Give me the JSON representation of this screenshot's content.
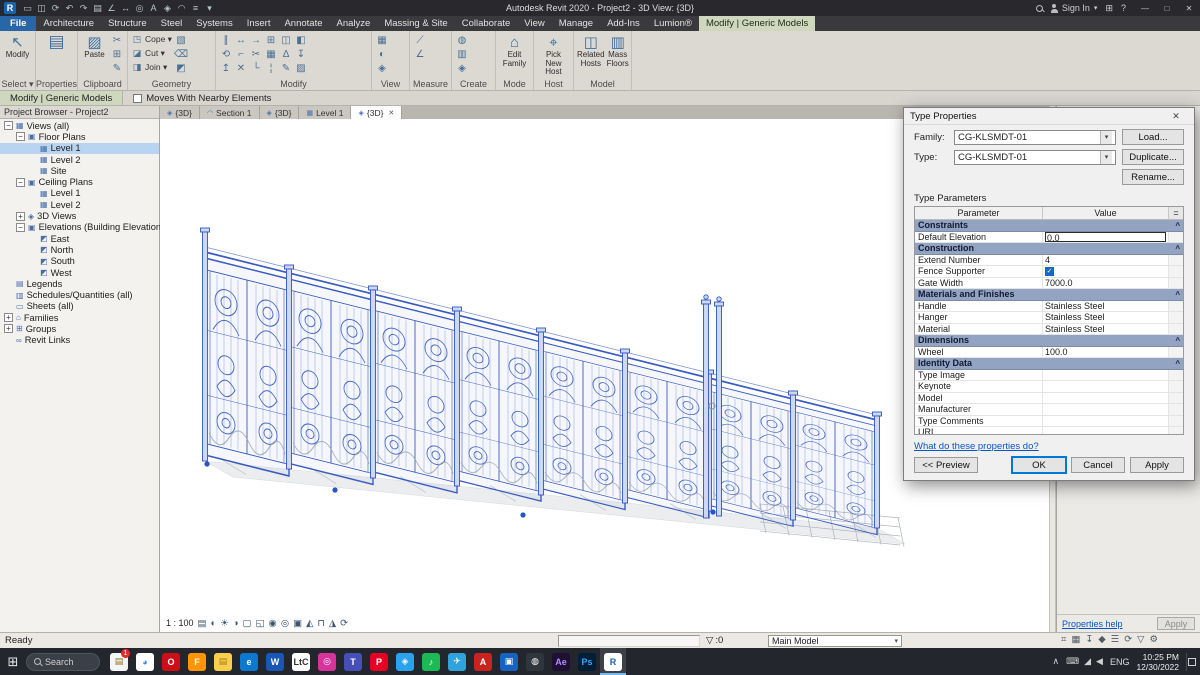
{
  "title_bar": {
    "app_icon_letter": "R",
    "quick_access": [
      {
        "name": "open-icon",
        "glyph": "▭"
      },
      {
        "name": "save-icon",
        "glyph": "◫"
      },
      {
        "name": "sync-icon",
        "glyph": "⟳"
      },
      {
        "name": "undo-icon",
        "glyph": "↶"
      },
      {
        "name": "redo-icon",
        "glyph": "↷"
      },
      {
        "name": "print-icon",
        "glyph": "▤"
      },
      {
        "name": "measure-icon",
        "glyph": "∠"
      },
      {
        "name": "dimension-icon",
        "glyph": "↔"
      },
      {
        "name": "tag-icon",
        "glyph": "◎"
      },
      {
        "name": "text-icon",
        "glyph": "A"
      },
      {
        "name": "3d-view-icon",
        "glyph": "◈"
      },
      {
        "name": "section-icon",
        "glyph": "◠"
      },
      {
        "name": "thin-lines-icon",
        "glyph": "≡"
      },
      {
        "name": "qat-dropdown-icon",
        "glyph": "▾"
      }
    ],
    "title": "Autodesk Revit 2020 - Project2 - 3D View: {3D}",
    "sign_in_label": "Sign In",
    "sign_in_caret": "▾",
    "apps_icon": "⊞",
    "help_icon": "?",
    "window_controls": [
      {
        "name": "minimize-button",
        "glyph": "—"
      },
      {
        "name": "maximize-button",
        "glyph": "□"
      },
      {
        "name": "close-button",
        "glyph": "✕"
      }
    ]
  },
  "ribbon": {
    "tabs": [
      {
        "label": "File",
        "file": true
      },
      {
        "label": "Architecture"
      },
      {
        "label": "Structure"
      },
      {
        "label": "Steel"
      },
      {
        "label": "Systems"
      },
      {
        "label": "Insert"
      },
      {
        "label": "Annotate"
      },
      {
        "label": "Analyze"
      },
      {
        "label": "Massing & Site"
      },
      {
        "label": "Collaborate"
      },
      {
        "label": "View"
      },
      {
        "label": "Manage"
      },
      {
        "label": "Add-Ins"
      },
      {
        "label": "Lumion®"
      },
      {
        "label": "Modify | Generic Models",
        "active": true
      }
    ],
    "glyphs": {
      "modify": "↖",
      "properties": "▤",
      "paste": "▨",
      "edit_family": "⌂",
      "pick_new_host": "⌖",
      "related_hosts": "◫",
      "mass_floors": "▥"
    },
    "panels": {
      "select": {
        "label": "Select ▾",
        "modify_button": "Modify"
      },
      "properties": {
        "label": "Properties"
      },
      "clipboard": {
        "label": "Clipboard",
        "paste_button": "Paste",
        "smalls": [
          {
            "name": "cut-icon",
            "glyph": "✂"
          },
          {
            "name": "copy-icon",
            "glyph": "⊞"
          },
          {
            "name": "match-type-icon",
            "glyph": "✎"
          }
        ]
      },
      "geometry": {
        "label": "Geometry",
        "rows": [
          {
            "name": "cope-button",
            "glyph": "◳",
            "label": "Cope ▾"
          },
          {
            "name": "cut-geometry-button",
            "glyph": "◪",
            "label": "Cut ▾"
          },
          {
            "name": "join-button",
            "glyph": "◨",
            "label": "Join ▾"
          }
        ],
        "smalls": [
          {
            "name": "paint-icon",
            "glyph": "▧"
          },
          {
            "name": "demolish-icon",
            "glyph": "⌫"
          },
          {
            "name": "wall-joins-icon",
            "glyph": "◩"
          }
        ]
      },
      "modify": {
        "label": "Modify",
        "smalls": [
          {
            "name": "align-icon",
            "glyph": "∥"
          },
          {
            "name": "move-icon",
            "glyph": "↔"
          },
          {
            "name": "offset-icon",
            "glyph": "→"
          },
          {
            "name": "copy-icon",
            "glyph": "⊞"
          },
          {
            "name": "mirror-pick-icon",
            "glyph": "◫"
          },
          {
            "name": "mirror-axis-icon",
            "glyph": "◧"
          },
          {
            "name": "rotate-icon",
            "glyph": "⟲"
          },
          {
            "name": "trim-extend-icon",
            "glyph": "⌐"
          },
          {
            "name": "split-icon",
            "glyph": "✂"
          },
          {
            "name": "array-icon",
            "glyph": "▦"
          },
          {
            "name": "scale-icon",
            "glyph": "∆"
          },
          {
            "name": "pin-icon",
            "glyph": "↧"
          },
          {
            "name": "unpin-icon",
            "glyph": "↥"
          },
          {
            "name": "delete-icon",
            "glyph": "✕"
          },
          {
            "name": "trim-corner-icon",
            "glyph": "└"
          },
          {
            "name": "split-gap-icon",
            "glyph": "¦"
          },
          {
            "name": "match-icon",
            "glyph": "✎"
          },
          {
            "name": "paint-bucket-icon",
            "glyph": "▨"
          }
        ]
      },
      "view": {
        "label": "View",
        "smalls": [
          {
            "name": "hidden-line-icon",
            "glyph": "▦"
          },
          {
            "name": "render-icon",
            "glyph": "◐"
          },
          {
            "name": "default-3d-icon",
            "glyph": "◈"
          }
        ]
      },
      "measure": {
        "label": "Measure",
        "smalls": [
          {
            "name": "measure-length-icon",
            "glyph": "⟋"
          },
          {
            "name": "angle-icon",
            "glyph": "∠"
          }
        ]
      },
      "create": {
        "label": "Create",
        "smalls": [
          {
            "name": "insulation-icon",
            "glyph": "◍"
          },
          {
            "name": "create-group-icon",
            "glyph": "▥"
          },
          {
            "name": "assembly-icon",
            "glyph": "◈"
          }
        ]
      },
      "mode": {
        "label": "Mode",
        "edit_family_button": "Edit\nFamily"
      },
      "host": {
        "label": "Host",
        "pick_new_host_button": "Pick\nNew Host"
      },
      "model": {
        "label": "Model",
        "related_hosts_button": "Related\nHosts",
        "mass_floors_button": "Mass\nFloors"
      }
    }
  },
  "options_bar": {
    "context_label": "Modify | Generic Models",
    "checkbox_label": "Moves With Nearby Elements"
  },
  "project_browser": {
    "title": "Project Browser - Project2",
    "tree": [
      {
        "label": "Views (all)",
        "indent": 0,
        "exp": "−",
        "g": "▦"
      },
      {
        "label": "Floor Plans",
        "indent": 1,
        "exp": "−",
        "g": "▣"
      },
      {
        "label": "Level 1",
        "indent": 2,
        "g": "▦",
        "selected": true
      },
      {
        "label": "Level 2",
        "indent": 2,
        "g": "▦"
      },
      {
        "label": "Site",
        "indent": 2,
        "g": "▦"
      },
      {
        "label": "Ceiling Plans",
        "indent": 1,
        "exp": "−",
        "g": "▣"
      },
      {
        "label": "Level 1",
        "indent": 2,
        "g": "▦"
      },
      {
        "label": "Level 2",
        "indent": 2,
        "g": "▦"
      },
      {
        "label": "3D Views",
        "indent": 1,
        "exp": "+",
        "g": "◈"
      },
      {
        "label": "Elevations (Building Elevation)",
        "indent": 1,
        "exp": "−",
        "g": "▣"
      },
      {
        "label": "East",
        "indent": 2,
        "g": "◩"
      },
      {
        "label": "North",
        "indent": 2,
        "g": "◩"
      },
      {
        "label": "South",
        "indent": 2,
        "g": "◩"
      },
      {
        "label": "West",
        "indent": 2,
        "g": "◩"
      },
      {
        "label": "Legends",
        "indent": 0,
        "g": "▤"
      },
      {
        "label": "Schedules/Quantities (all)",
        "indent": 0,
        "g": "▥"
      },
      {
        "label": "Sheets (all)",
        "indent": 0,
        "g": "▭"
      },
      {
        "label": "Families",
        "indent": 0,
        "exp": "+",
        "g": "⌂"
      },
      {
        "label": "Groups",
        "indent": 0,
        "exp": "+",
        "g": "⊞"
      },
      {
        "label": "Revit Links",
        "indent": 0,
        "g": "∞"
      }
    ]
  },
  "view_tabs": [
    {
      "label": "{3D}",
      "g": "◈"
    },
    {
      "label": "Section 1",
      "g": "◠"
    },
    {
      "label": "{3D}",
      "g": "◈"
    },
    {
      "label": "Level 1",
      "g": "▦"
    },
    {
      "label": "{3D}",
      "g": "◈",
      "active": true,
      "close": "✕"
    }
  ],
  "view_control_bar": {
    "scale": "1 : 100",
    "icons": [
      {
        "name": "detail-level-icon",
        "glyph": "▤"
      },
      {
        "name": "visual-style-icon",
        "glyph": "◐"
      },
      {
        "name": "sun-path-icon",
        "glyph": "☀"
      },
      {
        "name": "shadows-icon",
        "glyph": "◑"
      },
      {
        "name": "crop-view-icon",
        "glyph": "▢"
      },
      {
        "name": "crop-region-icon",
        "glyph": "◱"
      },
      {
        "name": "temporary-hide-icon",
        "glyph": "◉"
      },
      {
        "name": "reveal-hidden-icon",
        "glyph": "◎"
      },
      {
        "name": "temporary-view-icon",
        "glyph": "▣"
      },
      {
        "name": "worksharing-display-icon",
        "glyph": "◭"
      },
      {
        "name": "constraints-icon",
        "glyph": "⊓"
      },
      {
        "name": "analytical-model-icon",
        "glyph": "◮"
      },
      {
        "name": "navigation-icon",
        "glyph": "⟳"
      }
    ]
  },
  "properties_palette": {
    "help_link": "Properties help",
    "apply_button": "Apply"
  },
  "dialog": {
    "title": "Type Properties",
    "close_glyph": "✕",
    "family_label": "Family:",
    "family_value": "CG-KLSMDT-01",
    "type_label": "Type:",
    "type_value": "CG-KLSMDT-01",
    "combo_caret": "▾",
    "load_button": "Load...",
    "duplicate_button": "Duplicate...",
    "rename_button": "Rename...",
    "table_caption": "Type Parameters",
    "col_parameter": "Parameter",
    "col_value": "Value",
    "col_assoc": "=",
    "group_chevron": "^",
    "rows": [
      {
        "kind": "group",
        "label": "Constraints"
      },
      {
        "kind": "edit",
        "label": "Default Elevation",
        "value": "0.0",
        "focused": true
      },
      {
        "kind": "group",
        "label": "Construction"
      },
      {
        "kind": "text",
        "label": "Extend Number",
        "value": "4"
      },
      {
        "kind": "check",
        "label": "Fence Supporter",
        "checked": true
      },
      {
        "kind": "text",
        "label": "Gate Width",
        "value": "7000.0"
      },
      {
        "kind": "group",
        "label": "Materials and Finishes"
      },
      {
        "kind": "text",
        "label": "Handle",
        "value": "Stainless Steel"
      },
      {
        "kind": "text",
        "label": "Hanger",
        "value": "Stainless Steel"
      },
      {
        "kind": "text",
        "label": "Material",
        "value": "Stainless Steel"
      },
      {
        "kind": "group",
        "label": "Dimensions"
      },
      {
        "kind": "text",
        "label": "Wheel",
        "value": "100.0"
      },
      {
        "kind": "group",
        "label": "Identity Data"
      },
      {
        "kind": "text",
        "label": "Type Image",
        "value": ""
      },
      {
        "kind": "text",
        "label": "Keynote",
        "value": ""
      },
      {
        "kind": "text",
        "label": "Model",
        "value": ""
      },
      {
        "kind": "text",
        "label": "Manufacturer",
        "value": ""
      },
      {
        "kind": "text",
        "label": "Type Comments",
        "value": ""
      },
      {
        "kind": "text",
        "label": "URL",
        "value": ""
      }
    ],
    "help_link": "What do these properties do?",
    "preview_button": "<< Preview",
    "ok_button": "OK",
    "cancel_button": "Cancel",
    "apply_button": "Apply"
  },
  "status_bar": {
    "ready": "Ready",
    "filter_icon": "▽",
    "filter_count": ":0",
    "design_option": "Main Model",
    "dropdown_caret": "▾",
    "right_icons": [
      {
        "name": "select-links-icon",
        "glyph": "⌗"
      },
      {
        "name": "select-underlay-icon",
        "glyph": "▦"
      },
      {
        "name": "select-pinned-icon",
        "glyph": "↧"
      },
      {
        "name": "select-by-face-icon",
        "glyph": "◆"
      },
      {
        "name": "drag-on-selection-icon",
        "glyph": "☰"
      },
      {
        "name": "background-processes-icon",
        "glyph": "⟳"
      },
      {
        "name": "filter-icon",
        "glyph": "▽"
      },
      {
        "name": "settings-icon",
        "glyph": "⚙"
      }
    ]
  },
  "taskbar": {
    "start_glyph": "⊞",
    "search_label": "Search",
    "icons": [
      {
        "name": "sticky-notes-icon",
        "glyph": "▤",
        "bg": "#f5f5f5",
        "fg": "#8a6d1d",
        "badge": "1"
      },
      {
        "name": "chrome-icon",
        "glyph": "◕",
        "bg": "#ffffff",
        "fg": "#4285f4"
      },
      {
        "name": "opera-icon",
        "glyph": "O",
        "bg": "#cc0f16",
        "fg": "#ffffff"
      },
      {
        "name": "firefox-icon",
        "glyph": "F",
        "bg": "#ff9500",
        "fg": "#ffffff"
      },
      {
        "name": "file-explorer-icon",
        "glyph": "▤",
        "bg": "#f8ce4f",
        "fg": "#a57b18"
      },
      {
        "name": "edge-icon",
        "glyph": "e",
        "bg": "#0b79d0",
        "fg": "#ffffff"
      },
      {
        "name": "word-icon",
        "glyph": "W",
        "bg": "#1857b5",
        "fg": "#ffffff"
      },
      {
        "name": "ltc-icon",
        "glyph": "LtC",
        "bg": "#ffffff",
        "fg": "#333333"
      },
      {
        "name": "instagram-icon",
        "glyph": "◎",
        "bg": "#d6349c",
        "fg": "#ffffff"
      },
      {
        "name": "teams-icon",
        "glyph": "T",
        "bg": "#464eb8",
        "fg": "#ffffff"
      },
      {
        "name": "pinterest-icon",
        "glyph": "P",
        "bg": "#e60023",
        "fg": "#ffffff"
      },
      {
        "name": "code-icon",
        "glyph": "◈",
        "bg": "#2aa3ef",
        "fg": "#ffffff"
      },
      {
        "name": "spotify-icon",
        "glyph": "♪",
        "bg": "#1db954",
        "fg": "#ffffff"
      },
      {
        "name": "telegram-icon",
        "glyph": "✈",
        "bg": "#2ea3dc",
        "fg": "#ffffff"
      },
      {
        "name": "autodesk-icon",
        "glyph": "A",
        "bg": "#c6241c",
        "fg": "#ffffff"
      },
      {
        "name": "remote-desktop-icon",
        "glyph": "▣",
        "bg": "#1565c0",
        "fg": "#ffffff"
      },
      {
        "name": "obs-icon",
        "glyph": "◍",
        "bg": "#30363d",
        "fg": "#ffffff"
      },
      {
        "name": "after-effects-icon",
        "glyph": "Ae",
        "bg": "#1f1033",
        "fg": "#b08cff"
      },
      {
        "name": "photoshop-icon",
        "glyph": "Ps",
        "bg": "#001e36",
        "fg": "#31a8ff"
      },
      {
        "name": "revit-icon",
        "glyph": "R",
        "bg": "#ffffff",
        "fg": "#1763ad",
        "active": true
      }
    ],
    "tray": {
      "chevron": "∧",
      "icons": [
        {
          "name": "keyboard-icon",
          "glyph": "⌨"
        },
        {
          "name": "network-icon",
          "glyph": "◢"
        },
        {
          "name": "volume-icon",
          "glyph": "◀"
        }
      ],
      "lang": "ENG",
      "time": "10:25 PM",
      "date": "12/30/2022"
    }
  }
}
